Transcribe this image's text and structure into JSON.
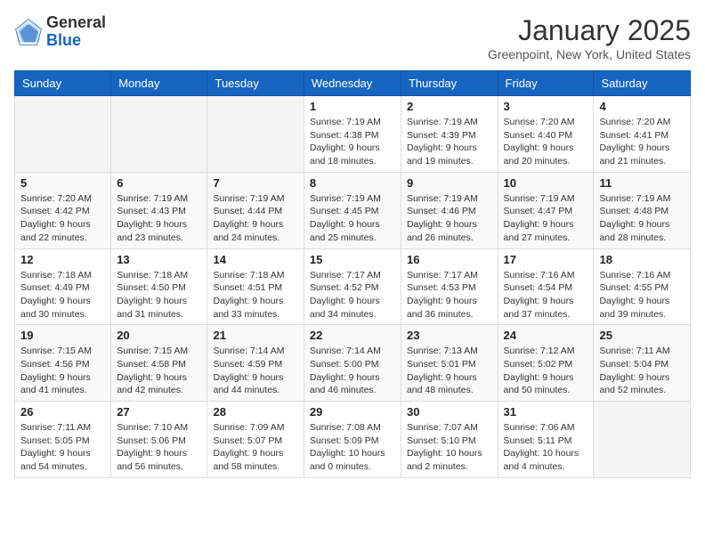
{
  "header": {
    "logo_general": "General",
    "logo_blue": "Blue",
    "month_title": "January 2025",
    "location": "Greenpoint, New York, United States"
  },
  "weekdays": [
    "Sunday",
    "Monday",
    "Tuesday",
    "Wednesday",
    "Thursday",
    "Friday",
    "Saturday"
  ],
  "weeks": [
    [
      {
        "day": "",
        "info": ""
      },
      {
        "day": "",
        "info": ""
      },
      {
        "day": "",
        "info": ""
      },
      {
        "day": "1",
        "info": "Sunrise: 7:19 AM\nSunset: 4:38 PM\nDaylight: 9 hours\nand 18 minutes."
      },
      {
        "day": "2",
        "info": "Sunrise: 7:19 AM\nSunset: 4:39 PM\nDaylight: 9 hours\nand 19 minutes."
      },
      {
        "day": "3",
        "info": "Sunrise: 7:20 AM\nSunset: 4:40 PM\nDaylight: 9 hours\nand 20 minutes."
      },
      {
        "day": "4",
        "info": "Sunrise: 7:20 AM\nSunset: 4:41 PM\nDaylight: 9 hours\nand 21 minutes."
      }
    ],
    [
      {
        "day": "5",
        "info": "Sunrise: 7:20 AM\nSunset: 4:42 PM\nDaylight: 9 hours\nand 22 minutes."
      },
      {
        "day": "6",
        "info": "Sunrise: 7:19 AM\nSunset: 4:43 PM\nDaylight: 9 hours\nand 23 minutes."
      },
      {
        "day": "7",
        "info": "Sunrise: 7:19 AM\nSunset: 4:44 PM\nDaylight: 9 hours\nand 24 minutes."
      },
      {
        "day": "8",
        "info": "Sunrise: 7:19 AM\nSunset: 4:45 PM\nDaylight: 9 hours\nand 25 minutes."
      },
      {
        "day": "9",
        "info": "Sunrise: 7:19 AM\nSunset: 4:46 PM\nDaylight: 9 hours\nand 26 minutes."
      },
      {
        "day": "10",
        "info": "Sunrise: 7:19 AM\nSunset: 4:47 PM\nDaylight: 9 hours\nand 27 minutes."
      },
      {
        "day": "11",
        "info": "Sunrise: 7:19 AM\nSunset: 4:48 PM\nDaylight: 9 hours\nand 28 minutes."
      }
    ],
    [
      {
        "day": "12",
        "info": "Sunrise: 7:18 AM\nSunset: 4:49 PM\nDaylight: 9 hours\nand 30 minutes."
      },
      {
        "day": "13",
        "info": "Sunrise: 7:18 AM\nSunset: 4:50 PM\nDaylight: 9 hours\nand 31 minutes."
      },
      {
        "day": "14",
        "info": "Sunrise: 7:18 AM\nSunset: 4:51 PM\nDaylight: 9 hours\nand 33 minutes."
      },
      {
        "day": "15",
        "info": "Sunrise: 7:17 AM\nSunset: 4:52 PM\nDaylight: 9 hours\nand 34 minutes."
      },
      {
        "day": "16",
        "info": "Sunrise: 7:17 AM\nSunset: 4:53 PM\nDaylight: 9 hours\nand 36 minutes."
      },
      {
        "day": "17",
        "info": "Sunrise: 7:16 AM\nSunset: 4:54 PM\nDaylight: 9 hours\nand 37 minutes."
      },
      {
        "day": "18",
        "info": "Sunrise: 7:16 AM\nSunset: 4:55 PM\nDaylight: 9 hours\nand 39 minutes."
      }
    ],
    [
      {
        "day": "19",
        "info": "Sunrise: 7:15 AM\nSunset: 4:56 PM\nDaylight: 9 hours\nand 41 minutes."
      },
      {
        "day": "20",
        "info": "Sunrise: 7:15 AM\nSunset: 4:58 PM\nDaylight: 9 hours\nand 42 minutes."
      },
      {
        "day": "21",
        "info": "Sunrise: 7:14 AM\nSunset: 4:59 PM\nDaylight: 9 hours\nand 44 minutes."
      },
      {
        "day": "22",
        "info": "Sunrise: 7:14 AM\nSunset: 5:00 PM\nDaylight: 9 hours\nand 46 minutes."
      },
      {
        "day": "23",
        "info": "Sunrise: 7:13 AM\nSunset: 5:01 PM\nDaylight: 9 hours\nand 48 minutes."
      },
      {
        "day": "24",
        "info": "Sunrise: 7:12 AM\nSunset: 5:02 PM\nDaylight: 9 hours\nand 50 minutes."
      },
      {
        "day": "25",
        "info": "Sunrise: 7:11 AM\nSunset: 5:04 PM\nDaylight: 9 hours\nand 52 minutes."
      }
    ],
    [
      {
        "day": "26",
        "info": "Sunrise: 7:11 AM\nSunset: 5:05 PM\nDaylight: 9 hours\nand 54 minutes."
      },
      {
        "day": "27",
        "info": "Sunrise: 7:10 AM\nSunset: 5:06 PM\nDaylight: 9 hours\nand 56 minutes."
      },
      {
        "day": "28",
        "info": "Sunrise: 7:09 AM\nSunset: 5:07 PM\nDaylight: 9 hours\nand 58 minutes."
      },
      {
        "day": "29",
        "info": "Sunrise: 7:08 AM\nSunset: 5:09 PM\nDaylight: 10 hours\nand 0 minutes."
      },
      {
        "day": "30",
        "info": "Sunrise: 7:07 AM\nSunset: 5:10 PM\nDaylight: 10 hours\nand 2 minutes."
      },
      {
        "day": "31",
        "info": "Sunrise: 7:06 AM\nSunset: 5:11 PM\nDaylight: 10 hours\nand 4 minutes."
      },
      {
        "day": "",
        "info": ""
      }
    ]
  ]
}
